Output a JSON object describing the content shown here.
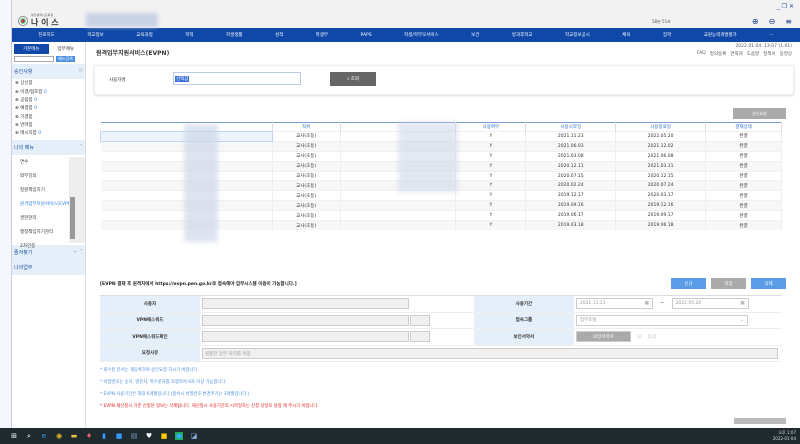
{
  "app": {
    "org": "부산광역시교육청",
    "name": "나 이 스",
    "session": "58분 51초"
  },
  "nav": [
    "진로지도",
    "학교정보",
    "교육과정",
    "학적",
    "학생생활",
    "성적",
    "학생부",
    "PAPS",
    "학생/학부모서비스",
    "보건",
    "방과후학교",
    "학교정보공시",
    "체육",
    "장학",
    "교원능력개발평가",
    "···"
  ],
  "sidebar": {
    "tabs": [
      "기본메뉴",
      "업무메뉴"
    ],
    "search_button": "메뉴검색",
    "search_value": "",
    "approval_title": "승인사항",
    "approval": [
      {
        "label": "상신함",
        "count": ""
      },
      {
        "label": "미결/협조함",
        "count": "0"
      },
      {
        "label": "공람함",
        "count": "0"
      },
      {
        "label": "예결함",
        "count": "0"
      },
      {
        "label": "기결함",
        "count": ""
      },
      {
        "label": "반려함",
        "count": ""
      },
      {
        "label": "메시지함",
        "count": "0"
      }
    ],
    "my_menu_title": "나의 메뉴",
    "my_menu": [
      "연수",
      "외부강의",
      "정원책임지기",
      "원격업무지원서비스(EVPN)",
      "권한관리",
      "행정책임지기관리",
      "2차인증"
    ],
    "favorites_title": "즐겨찾기",
    "my_work_title": "나의업무"
  },
  "main": {
    "title": "원격업무지원서비스(EVPN)",
    "datetime": "2022.01.04. 13:07 (1.01)",
    "links": [
      "FAQ",
      "정의등록",
      "연락처",
      "도움말",
      "정책서",
      "동영상"
    ],
    "search": {
      "label": "사용자명",
      "value": "선택값",
      "button": "조회"
    },
    "approve_button": "승인요청",
    "columns": [
      "",
      "직위",
      "",
      "사용여부",
      "사용시작일",
      "사용종료일",
      "결재상태"
    ],
    "rows": [
      [
        "교사(초등)",
        "Y",
        "2021.11.23",
        "2022.05.20",
        "완결"
      ],
      [
        "교사(초등)",
        "Y",
        "2021.06.03",
        "2021.12.02",
        "완결"
      ],
      [
        "교사(초등)",
        "Y",
        "2021.03.08",
        "2021.06.08",
        "완결"
      ],
      [
        "교사(초등)",
        "Y",
        "2020.12.11",
        "2021.03.11",
        "완결"
      ],
      [
        "교사(초등)",
        "Y",
        "2020.07.15",
        "2020.12.15",
        "완결"
      ],
      [
        "교사(초등)",
        "Y",
        "2020.02.24",
        "2020.07.24",
        "완결"
      ],
      [
        "교사(초등)",
        "Y",
        "2019.12.17",
        "2020.03.17",
        "완결"
      ],
      [
        "교사(초등)",
        "Y",
        "2019.09.16",
        "2019.12.16",
        "완결"
      ],
      [
        "교사(초등)",
        "Y",
        "2019.06.17",
        "2019.09.17",
        "완결"
      ],
      [
        "교사(초등)",
        "Y",
        "2019.03.18",
        "2019.06.18",
        "완결"
      ]
    ],
    "notice": "[EVPN 결재 후 원격지에서 https://evpn.pen.go.kr로 접속해야 업무시스템 이용이 가능합니다.]",
    "buttons": {
      "new": "신규",
      "save": "저장",
      "delete": "삭제"
    },
    "form": {
      "user": "사용자",
      "vpn_pw": "VPN패스워드",
      "vpn_pw_confirm": "VPN패스워드확인",
      "reason": "요청사유",
      "reason_value": "원활한 업무 처리를 위함",
      "period": "사용기간",
      "start": "2021.11.23",
      "end": "2022.05.20",
      "tilde": "~",
      "group": "접속그룹",
      "group_value": "업무포털",
      "pledge": "보안서약서",
      "pledge_button": "보안서약서",
      "agree": "동의"
    },
    "notes": [
      "* 회수된 문서는 재등록하여 승인요청 하시기 바랍니다.",
      "* 비밀번호는 숫자, 영문자, 특수문자를 조합하여 9자 이상 가능합니다.",
      "* EVPN 사용기간은 최대 6개월입니다.(접속시 비밀번호 변경주기는 3개월입니다.)",
      "* EVPN 재신청시 기존 신청된 정보는 삭제됩니다. 재신청시 사용기간의 시작일자는 신청 당일로 설정 해 주시기 바랍니다."
    ]
  },
  "taskbar": {
    "time": "오후 1:07",
    "date": "2022-01-04"
  },
  "colors": {
    "nav": "#0f48a8",
    "accent": "#4a8ee0",
    "warning": "#e02020"
  }
}
